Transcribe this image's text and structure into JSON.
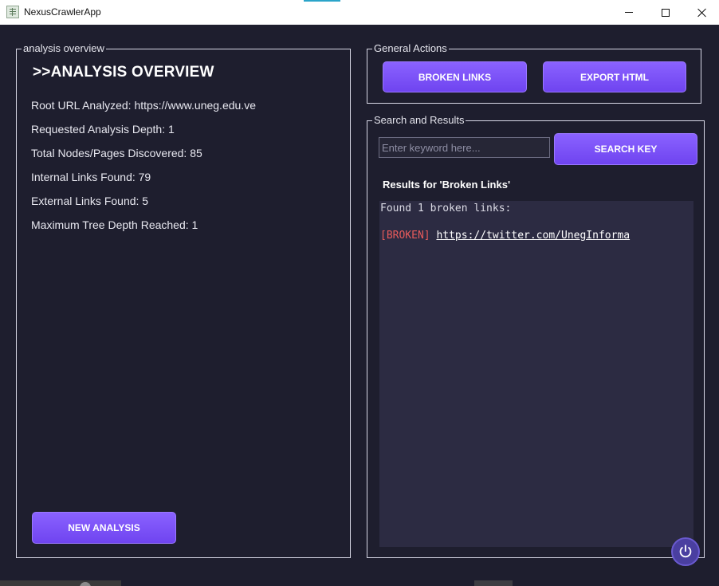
{
  "window": {
    "title": "NexusCrawlerApp",
    "controls": {
      "minimize": "minimize-icon",
      "maximize": "maximize-icon",
      "close": "close-icon"
    }
  },
  "overview": {
    "group_title": "analysis overview",
    "heading": ">>ANALYSIS OVERVIEW",
    "stats": [
      "Root URL Analyzed: https://www.uneg.edu.ve",
      "Requested Analysis Depth: 1",
      "Total Nodes/Pages Discovered: 85",
      "Internal Links Found: 79",
      "External Links Found: 5",
      "Maximum Tree Depth Reached: 1"
    ],
    "new_analysis_label": "NEW ANALYSIS"
  },
  "actions": {
    "group_title": "General Actions",
    "broken_links_label": "BROKEN LINKS",
    "export_html_label": "EXPORT HTML"
  },
  "search": {
    "group_title": "Search and Results",
    "placeholder": "Enter keyword here...",
    "value": "",
    "search_key_label": "SEARCH KEY",
    "results_heading": "Results for 'Broken Links'",
    "results_summary": "Found 1 broken links:",
    "results": [
      {
        "tag": "[BROKEN]",
        "url": "https://twitter.com/UnegInforma"
      }
    ]
  },
  "colors": {
    "background": "#1e1e2e",
    "button": "#7b54f8",
    "results_bg": "#2c2b42",
    "broken_tag": "#e85b5b"
  },
  "icons": {
    "power": "power-icon",
    "app": "app-icon"
  }
}
